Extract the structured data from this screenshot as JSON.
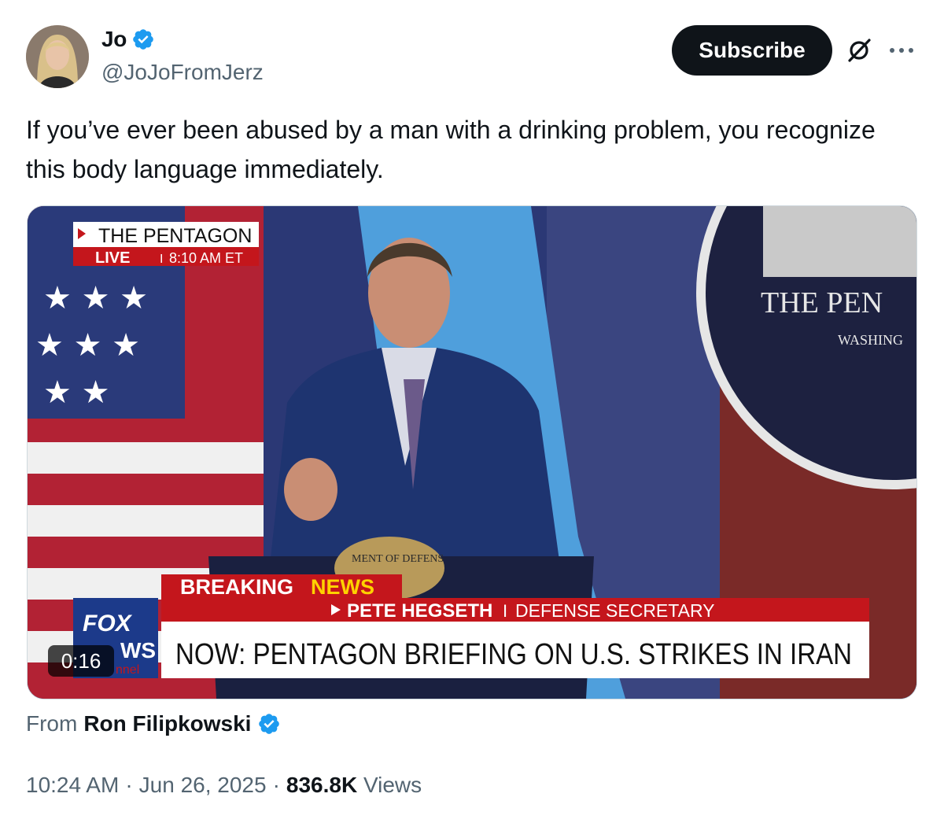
{
  "author": {
    "name": "Jo",
    "handle": "@JoJoFromJerz",
    "verified": true
  },
  "actions": {
    "subscribe_label": "Subscribe",
    "grok_icon": "grok-icon",
    "more_icon": "more-icon"
  },
  "tweet": {
    "text": "If you’ve ever been abused by a man with a drinking problem, you recognize this body language immediately."
  },
  "video": {
    "duration": "0:16",
    "overlay": {
      "location": "THE PENTAGON",
      "live": "LIVE",
      "time": "8:10 AM ET",
      "breaking": "BREAKING",
      "news": "NEWS",
      "speaker": "PETE HEGSETH",
      "speaker_title": "DEFENSE SECRETARY",
      "headline": "NOW: PENTAGON BRIEFING ON U.S. STRIKES IN IRAN",
      "seal_text": "THE PEN",
      "seal_sub": "WASHING",
      "podium_seal": "MENT OF DEFENS",
      "network_top": "FOX",
      "network_bottom": "WS",
      "network_extra": "nnel"
    }
  },
  "source": {
    "from_label": "From",
    "name": "Ron Filipkowski",
    "verified": true
  },
  "meta": {
    "time": "10:24 AM",
    "date": "Jun 26, 2025",
    "views_count": "836.8K",
    "views_label": "Views",
    "separator": "·"
  },
  "colors": {
    "verified_blue": "#1d9bf0",
    "text_primary": "#0f1419",
    "text_secondary": "#536471",
    "fox_red": "#c4161c"
  }
}
